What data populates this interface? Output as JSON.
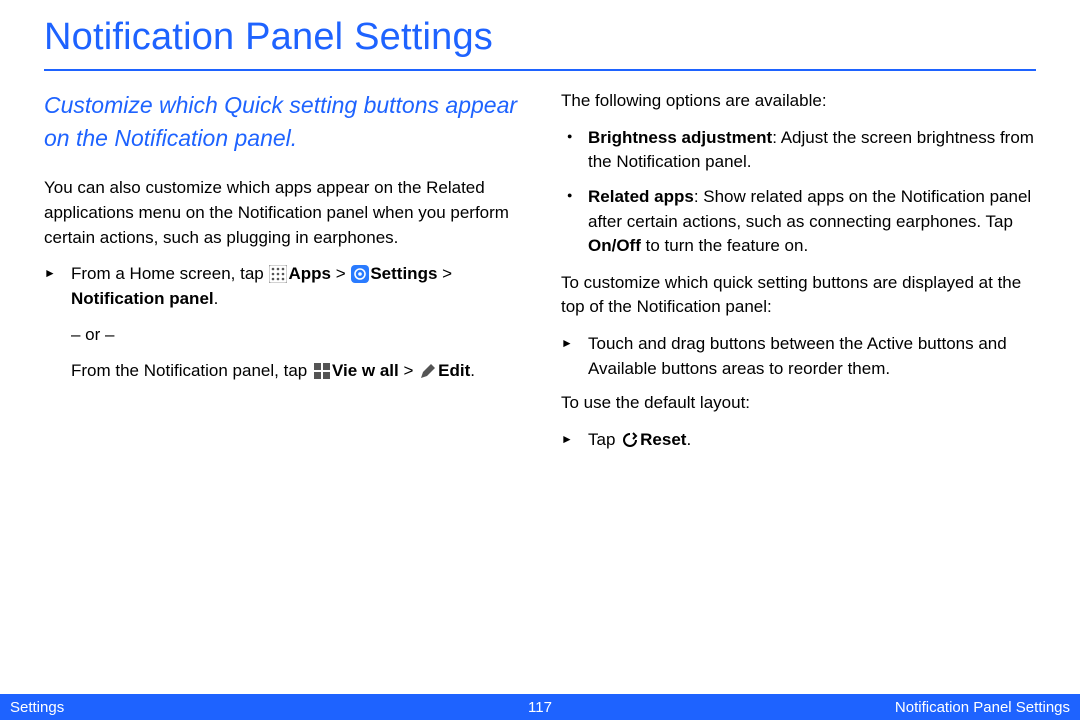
{
  "title": "Notification Panel Settings",
  "subtitle": "Customize which Quick setting buttons appear on the Notification panel.",
  "left": {
    "intro": "You can also customize which apps appear on the Related applications menu on the Notification panel when you perform certain actions, such as plugging in earphones.",
    "step1_pre": "From a Home screen, tap ",
    "apps": "Apps",
    "sep1": " > ",
    "settings": "Settings",
    "sep2": " > ",
    "notif_panel": "Notification panel",
    "period": ".",
    "or": "– or –",
    "step2_pre": "From the Notification panel, tap ",
    "viewall": "Vie w all",
    "sep3": " > ",
    "edit": "Edit",
    "period2": "."
  },
  "right": {
    "lead": "The following options are available:",
    "b1_title": "Brightness adjustment",
    "b1_body": ": Adjust the screen brightness from the Notification panel.",
    "b2_title": "Related apps",
    "b2_body_a": ": Show related apps on the Notification panel after certain actions, such as connecting earphones. Tap ",
    "onoff": "On/Off",
    "b2_body_b": " to turn the feature on.",
    "customize": "To customize which quick setting buttons are displayed at the top of the Notification panel:",
    "drag": "Touch and drag buttons between the Active buttons and Available buttons areas to reorder them.",
    "default_lead": "To use the default layout:",
    "tap": "Tap ",
    "reset": "Reset",
    "period": "."
  },
  "footer": {
    "left": "Settings",
    "center": "117",
    "right": "Notification Panel Settings"
  }
}
